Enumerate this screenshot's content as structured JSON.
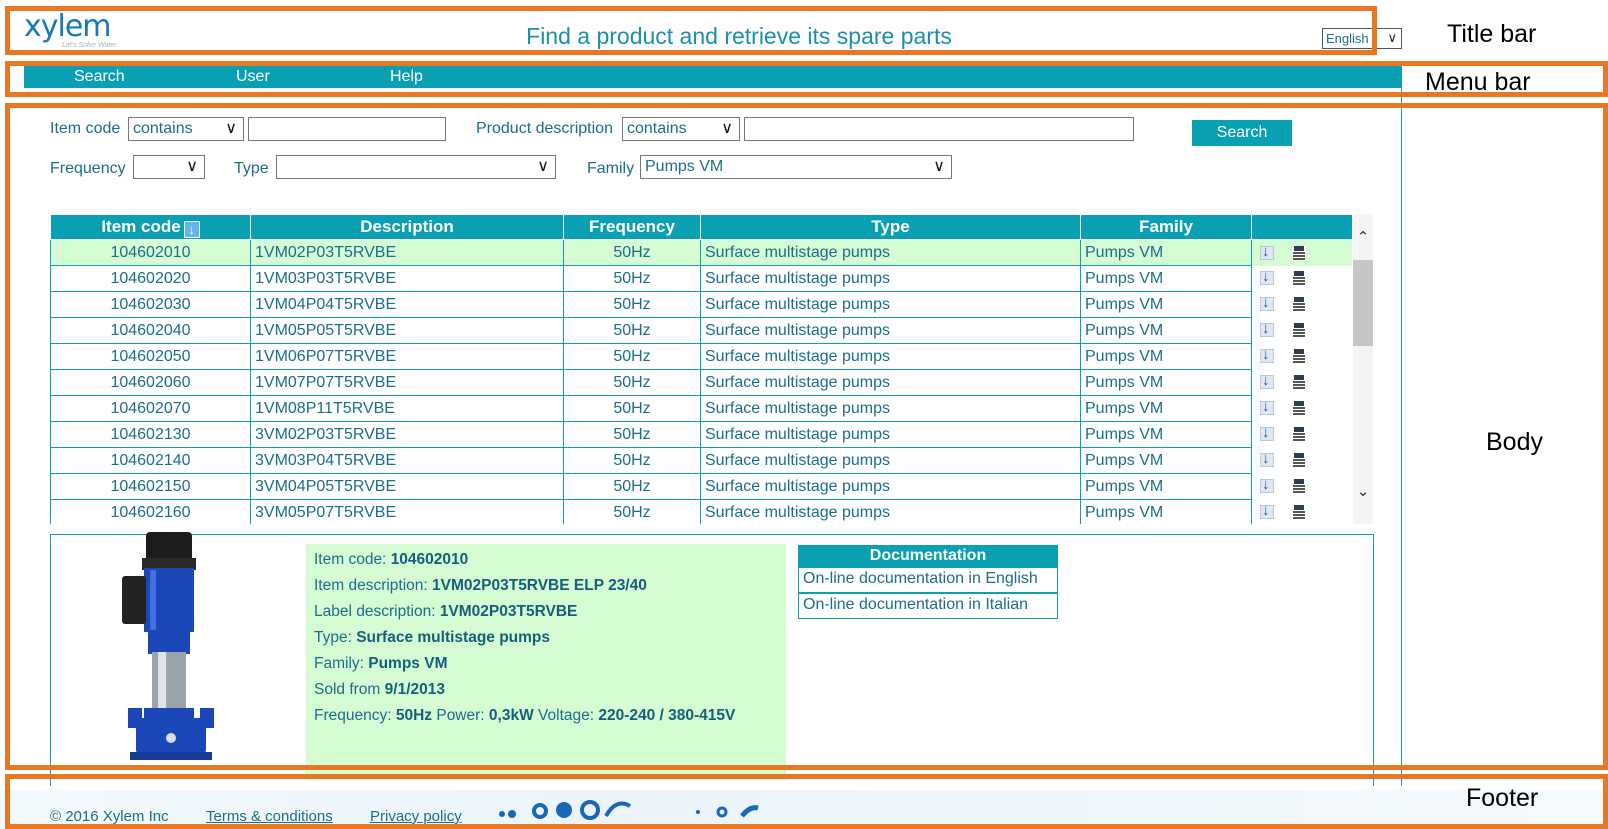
{
  "header": {
    "logo": "xylem",
    "tagline": "Let's Solve Water",
    "title": "Find a product and retrieve its spare parts",
    "language": "English"
  },
  "menu": {
    "items": [
      "Search",
      "User",
      "Help"
    ]
  },
  "filters": {
    "item_code_label": "Item code",
    "item_code_op": "contains",
    "product_desc_label": "Product description",
    "product_desc_op": "contains",
    "search_button": "Search",
    "frequency_label": "Frequency",
    "type_label": "Type",
    "family_label": "Family",
    "family_value": "Pumps VM"
  },
  "table": {
    "columns": [
      "Item code",
      "Description",
      "Frequency",
      "Type",
      "Family"
    ],
    "rows": [
      [
        "104602010",
        "1VM02P03T5RVBE",
        "50Hz",
        "Surface multistage pumps",
        "Pumps VM"
      ],
      [
        "104602020",
        "1VM03P03T5RVBE",
        "50Hz",
        "Surface multistage pumps",
        "Pumps VM"
      ],
      [
        "104602030",
        "1VM04P04T5RVBE",
        "50Hz",
        "Surface multistage pumps",
        "Pumps VM"
      ],
      [
        "104602040",
        "1VM05P05T5RVBE",
        "50Hz",
        "Surface multistage pumps",
        "Pumps VM"
      ],
      [
        "104602050",
        "1VM06P07T5RVBE",
        "50Hz",
        "Surface multistage pumps",
        "Pumps VM"
      ],
      [
        "104602060",
        "1VM07P07T5RVBE",
        "50Hz",
        "Surface multistage pumps",
        "Pumps VM"
      ],
      [
        "104602070",
        "1VM08P11T5RVBE",
        "50Hz",
        "Surface multistage pumps",
        "Pumps VM"
      ],
      [
        "104602130",
        "3VM02P03T5RVBE",
        "50Hz",
        "Surface multistage pumps",
        "Pumps VM"
      ],
      [
        "104602140",
        "3VM03P04T5RVBE",
        "50Hz",
        "Surface multistage pumps",
        "Pumps VM"
      ],
      [
        "104602150",
        "3VM04P05T5RVBE",
        "50Hz",
        "Surface multistage pumps",
        "Pumps VM"
      ],
      [
        "104602160",
        "3VM05P07T5RVBE",
        "50Hz",
        "Surface multistage pumps",
        "Pumps VM"
      ]
    ]
  },
  "detail": {
    "item_code_label": "Item code: ",
    "item_code": "104602010",
    "item_desc_label": "Item description: ",
    "item_desc": "1VM02P03T5RVBE ELP 23/40",
    "label_desc_label": "Label description: ",
    "label_desc": "1VM02P03T5RVBE",
    "type_label": "Type: ",
    "type": "Surface multistage pumps",
    "family_label": "Family: ",
    "family": "Pumps VM",
    "sold_from_label": "Sold from ",
    "sold_from": "9/1/2013",
    "frequency_label": "Frequency: ",
    "frequency": "50Hz",
    "power_label": " Power: ",
    "power": "0,3kW",
    "voltage_label": " Voltage: ",
    "voltage": "220-240 / 380-415V"
  },
  "documentation": {
    "header": "Documentation",
    "links": [
      "On-line documentation in English",
      "On-line documentation in Italian"
    ]
  },
  "footer": {
    "copyright": "© 2016 Xylem Inc",
    "terms": "Terms & conditions",
    "privacy": "Privacy policy"
  },
  "annotations": {
    "title_bar": "Title bar",
    "menu_bar": "Menu bar",
    "body": "Body",
    "footer": "Footer"
  },
  "colors": {
    "accent": "#0aa0b4",
    "annotation": "#e87722",
    "selected_row": "#d6fcd4",
    "text": "#1a6e8a"
  }
}
